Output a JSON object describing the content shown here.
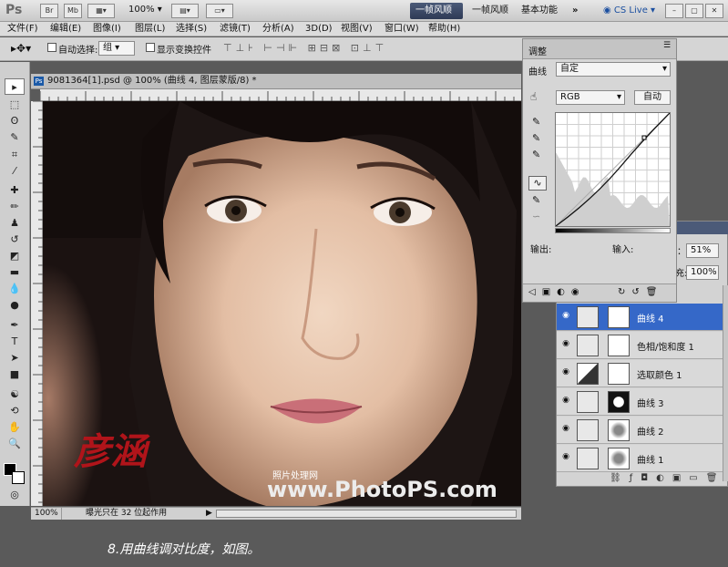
{
  "appbar": {
    "logo": "Ps",
    "br": "Br",
    "mb": "Mb",
    "zoom": "100%",
    "workspaces": [
      "一帧风顺1",
      "一帧风顺",
      "基本功能"
    ],
    "more": "»",
    "cslive": "CS Live"
  },
  "menu": [
    "文件(F)",
    "编辑(E)",
    "图像(I)",
    "图层(L)",
    "选择(S)",
    "滤镜(T)",
    "分析(A)",
    "3D(D)",
    "视图(V)",
    "窗口(W)",
    "帮助(H)"
  ],
  "options": {
    "auto_select_label": "自动选择:",
    "auto_select_value": "组",
    "show_transform": "显示变换控件"
  },
  "document": {
    "tab_title": "9081364[1].psd @ 100% (曲线 4, 图层蒙版/8) *",
    "zoom": "100%",
    "status_text": "曝光只在 32 位起作用",
    "signature": "彦涵",
    "watermark_small": "照片处理网",
    "watermark_url": "www.PhotoPS.com"
  },
  "adjust": {
    "title": "调整",
    "type_label": "曲线",
    "preset": "自定",
    "channel": "RGB",
    "auto_button": "自动",
    "output_label": "输出:",
    "input_label": "输入:"
  },
  "layers_side": {
    "opacity": "51%",
    "fill": "100%"
  },
  "layers": [
    {
      "name": "曲线 4",
      "selected": true
    },
    {
      "name": "色相/饱和度 1",
      "selected": false
    },
    {
      "name": "选取颜色 1",
      "selected": false
    },
    {
      "name": "曲线 3",
      "selected": false
    },
    {
      "name": "曲线 2",
      "selected": false
    },
    {
      "name": "曲线 1",
      "selected": false
    }
  ],
  "caption": "8.用曲线调对比度，如图。",
  "colors": {
    "accent": "#3568c8",
    "signature": "#b0141a",
    "panel": "#d6d6d6"
  }
}
